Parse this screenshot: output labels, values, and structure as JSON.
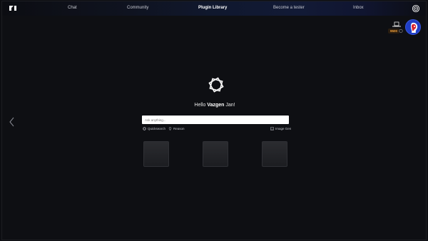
{
  "nav": {
    "items": [
      {
        "label": "Chat",
        "active": false
      },
      {
        "label": "Community",
        "active": false
      },
      {
        "label": "Plugin Library",
        "active": true
      },
      {
        "label": "Become a tester",
        "active": false
      },
      {
        "label": "Inbox",
        "active": false
      }
    ],
    "logo_icon": "brand-logo-icon",
    "settings_icon": "settings-icon"
  },
  "user": {
    "credits": "9500",
    "hat_icon": "hat-icon",
    "avatar_icon": "avatar-icon"
  },
  "main": {
    "greeting_prefix": "Hello ",
    "greeting_name": "Vazgen",
    "greeting_suffix": " Jan!",
    "search_placeholder": "Ask anything...",
    "options": {
      "quicksearch": "Quicksearch",
      "reason": "Reason",
      "image_gen": "Image Gen"
    }
  },
  "colors": {
    "background": "#0e0f13",
    "accent": "#1f3fc7",
    "credits": "#f3a13a"
  }
}
